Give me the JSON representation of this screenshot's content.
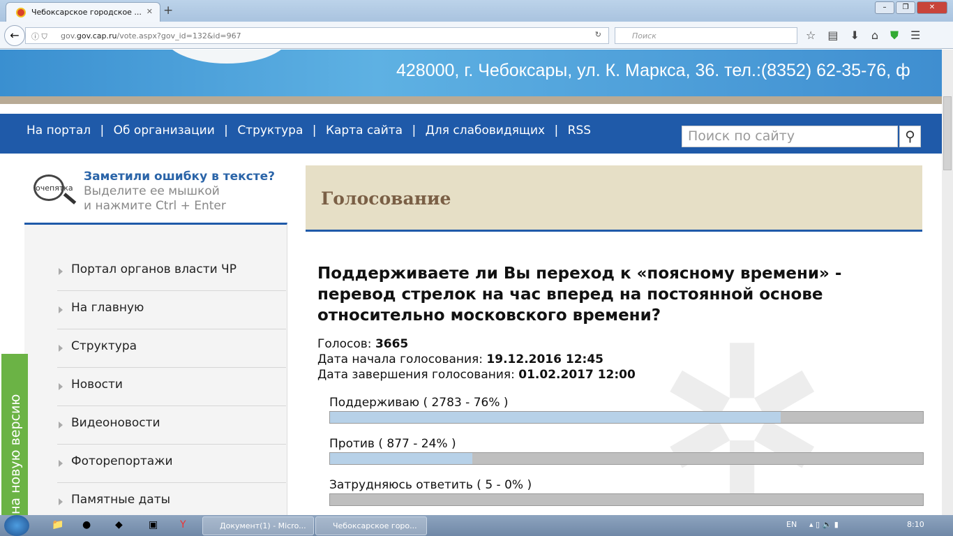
{
  "browser": {
    "tab_title": "Чебоксарское городское ...",
    "url_domain": "gov.cap.ru",
    "url_path": "/vote.aspx?gov_id=132&id=967",
    "url_prefix": "gov.",
    "search_placeholder": "Поиск"
  },
  "banner": {
    "address": "428000, г. Чебоксары, ул. К. Маркса, 36. тел.:(8352) 62-35-76, ф"
  },
  "topnav": {
    "links": [
      "На портал",
      "Об организации",
      "Структура",
      "Карта сайта",
      "Для слабовидящих",
      "RSS"
    ],
    "separator": "|",
    "search_placeholder": "Поиск по сайту"
  },
  "typo": {
    "logo_text": "очепятка",
    "title": "Заметили ошибку в тексте?",
    "line1": "Выделите ее мышкой",
    "line2": "и нажмите Ctrl + Enter"
  },
  "sidebar": {
    "items": [
      "Портал органов власти ЧР",
      "На главную",
      "Структура",
      "Новости",
      "Видеоновости",
      "Фоторепортажи",
      "Памятные даты"
    ]
  },
  "new_version_tab": "на новую версию",
  "main": {
    "heading": "Голосование",
    "question": "Поддерживаете ли Вы переход к «поясному времени» - перевод стрелок на час вперед на постоянной основе относительно московского времени?",
    "votes_label": "Голосов:",
    "votes": "3665",
    "start_label": "Дата начала голосования:",
    "start": "19.12.2016 12:45",
    "end_label": "Дата завершения голосования:",
    "end": "01.02.2017 12:00",
    "options": [
      {
        "label": "Поддерживаю ( 2783 - 76% )",
        "percent": 76
      },
      {
        "label": "Против ( 877 - 24% )",
        "percent": 24
      },
      {
        "label": "Затрудняюсь ответить ( 5 - 0% )",
        "percent": 0
      }
    ]
  },
  "taskbar": {
    "windows": [
      "Документ(1) - Micro...",
      "Чебоксарское горо..."
    ],
    "lang": "EN",
    "time": "8:10"
  }
}
